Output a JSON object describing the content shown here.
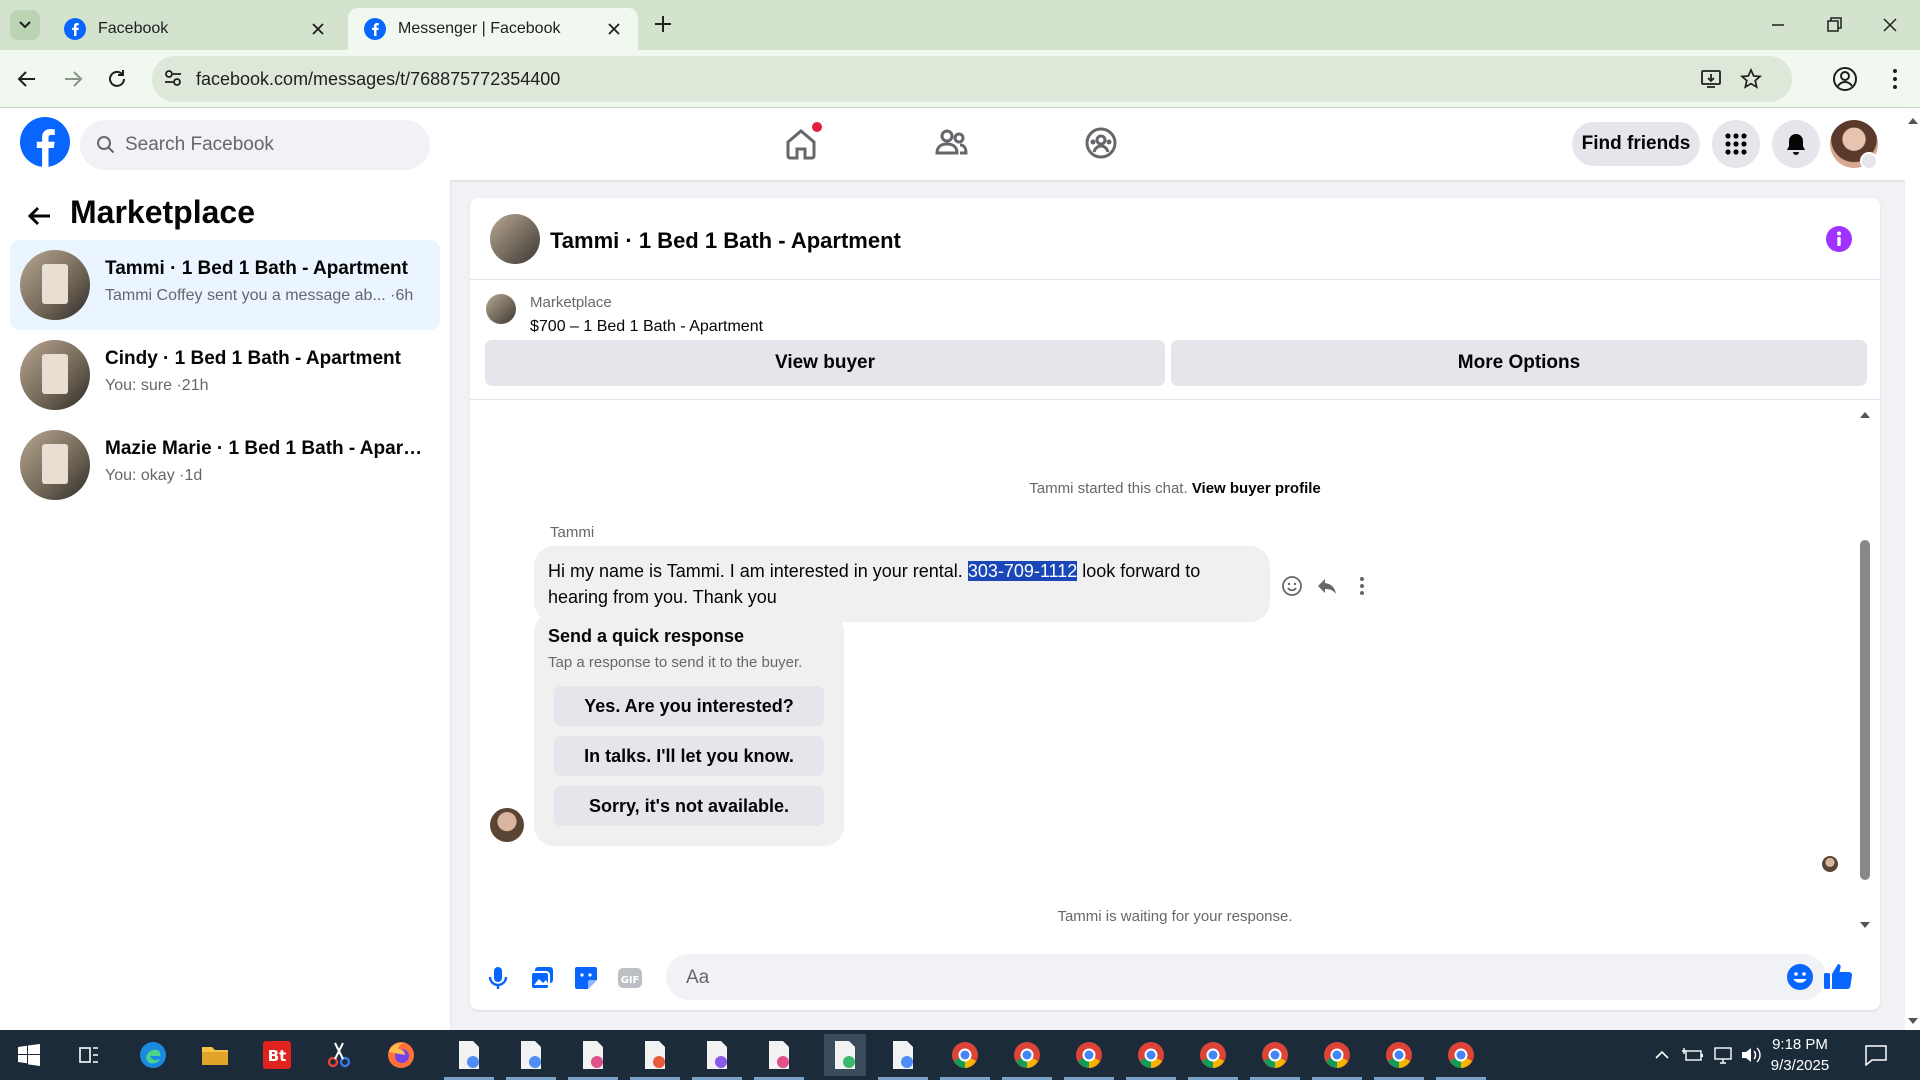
{
  "browser": {
    "tabs": [
      {
        "title": "Facebook"
      },
      {
        "title": "Messenger | Facebook"
      }
    ],
    "url": "facebook.com/messages/t/768875772354400"
  },
  "fb": {
    "search_placeholder": "Search Facebook",
    "find_friends": "Find friends"
  },
  "left": {
    "title": "Marketplace",
    "conversations": [
      {
        "title": "Tammi · 1 Bed 1 Bath - Apartment",
        "sub": "Tammi Coffey sent you a message ab... ·6h"
      },
      {
        "title": "Cindy · 1 Bed 1 Bath - Apartment",
        "sub": "You: sure ·21h"
      },
      {
        "title": "Mazie Marie · 1 Bed 1 Bath - Apart...",
        "sub": "You: okay ·1d"
      }
    ]
  },
  "chat": {
    "title": "Tammi · 1 Bed 1 Bath - Apartment",
    "marketplace_label": "Marketplace",
    "listing": "$700 – 1 Bed 1 Bath - Apartment",
    "view_buyer": "View buyer",
    "more_options": "More Options",
    "started_text": "Tammi started this chat.",
    "view_buyer_profile": "View buyer profile",
    "sender": "Tammi",
    "message_before": "Hi my name is Tammi. I am interested in your rental. ",
    "message_highlight": "303-709-1112",
    "message_after": " look forward to hearing from you. Thank you",
    "quick_title": "Send a quick response",
    "quick_sub": "Tap a response to send it to the buyer.",
    "quick_responses": [
      "Yes. Are you interested?",
      "In talks. I'll let you know.",
      "Sorry, it's not available."
    ],
    "waiting": "Tammi is waiting for your response.",
    "composer_placeholder": "Aa"
  },
  "taskbar": {
    "time": "9:18 PM",
    "date": "9/3/2025"
  },
  "colors": {
    "fb_blue": "#0866ff",
    "info_purple": "#a033ff",
    "highlight": "#1a47b8"
  }
}
